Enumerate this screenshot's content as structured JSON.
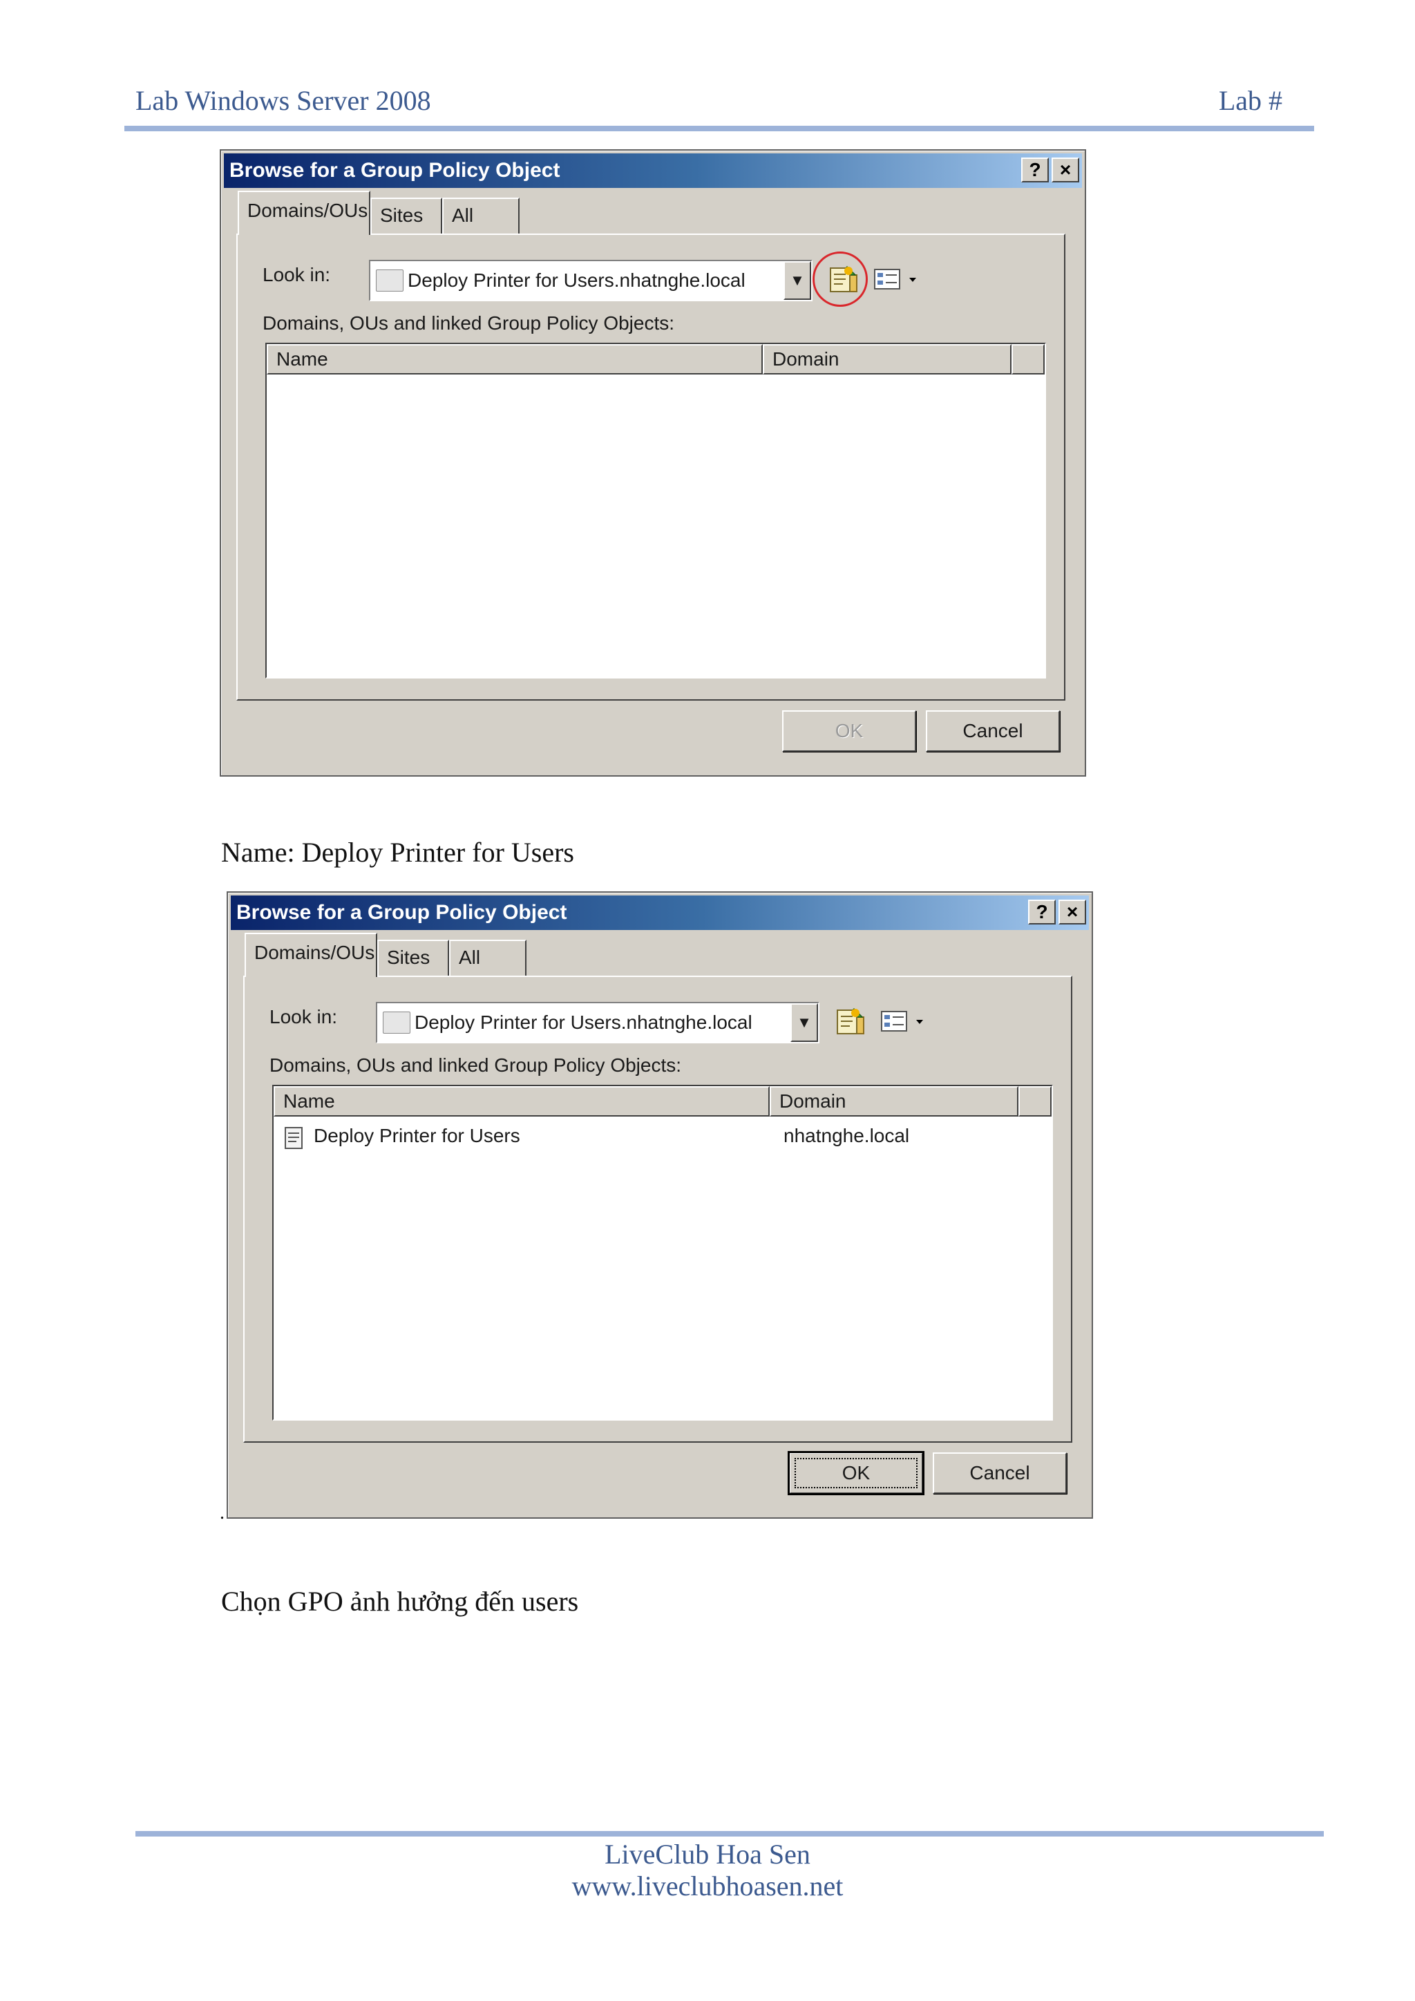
{
  "header": {
    "left": "Lab Windows Server 2008",
    "right": "Lab #"
  },
  "dialogs": [
    {
      "title": "Browse for a Group Policy Object",
      "help_label": "?",
      "close_label": "×",
      "tabs": [
        "Domains/OUs",
        "Sites",
        "All"
      ],
      "active_tab": "Domains/OUs",
      "look_in_label": "Look in:",
      "look_in_value": "Deploy Printer for Users.nhatnghe.local",
      "list_caption": "Domains, OUs and linked Group Policy Objects:",
      "columns": [
        "Name",
        "Domain"
      ],
      "rows": [],
      "new_gpo_highlighted": true,
      "ok_label": "OK",
      "ok_enabled": false,
      "cancel_label": "Cancel"
    },
    {
      "title": "Browse for a Group Policy Object",
      "help_label": "?",
      "close_label": "×",
      "tabs": [
        "Domains/OUs",
        "Sites",
        "All"
      ],
      "active_tab": "Domains/OUs",
      "look_in_label": "Look in:",
      "look_in_value": "Deploy Printer for Users.nhatnghe.local",
      "list_caption": "Domains, OUs and linked Group Policy Objects:",
      "columns": [
        "Name",
        "Domain"
      ],
      "rows": [
        {
          "name": "Deploy Printer for Users",
          "domain": "nhatnghe.local"
        }
      ],
      "new_gpo_highlighted": false,
      "ok_label": "OK",
      "ok_enabled": true,
      "cancel_label": "Cancel"
    }
  ],
  "text": {
    "name_line": "Name: Deploy Printer for Users",
    "dot": ".",
    "choose_line": "Chọn GPO ảnh hưởng đến users"
  },
  "footer": {
    "line1": "LiveClub Hoa Sen",
    "line2": "www.liveclubhoasen.net"
  },
  "colors": {
    "header_blue": "#3c5a8f",
    "rule": "#9db3d9",
    "dialog_face": "#d4d0c8",
    "title_bar": "#0a246a",
    "highlight_circle": "#d9262b"
  },
  "icons": [
    "folder-icon",
    "up-one-level-icon",
    "new-gpo-icon",
    "view-menu-icon",
    "gpo-icon"
  ]
}
